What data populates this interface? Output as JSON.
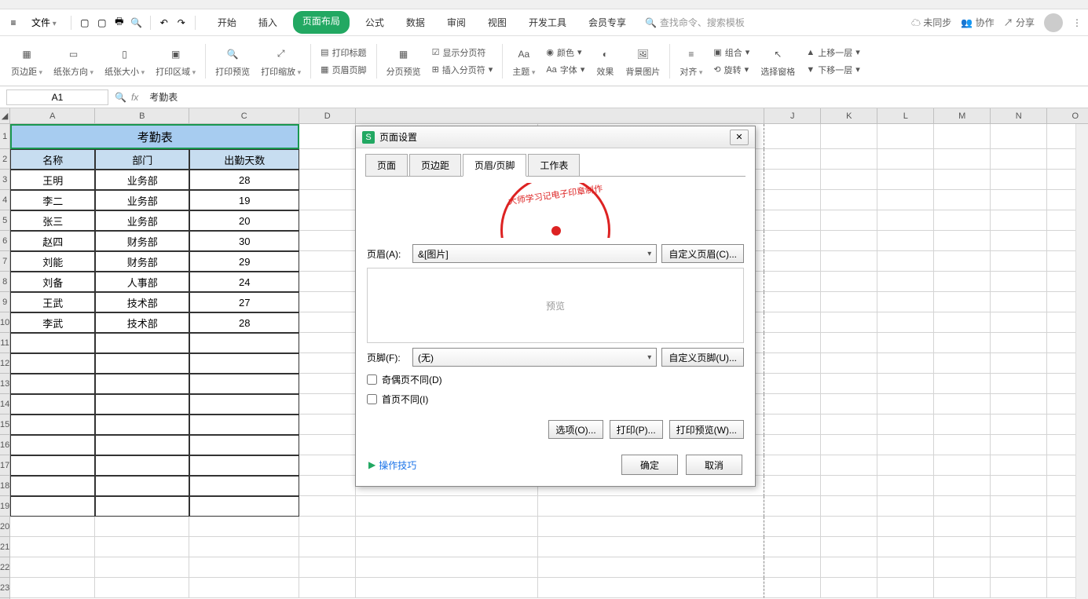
{
  "menubar": {
    "file": "文件",
    "tabs": [
      "开始",
      "插入",
      "页面布局",
      "公式",
      "数据",
      "审阅",
      "视图",
      "开发工具",
      "会员专享"
    ],
    "active_tab": 2,
    "search_placeholder": "查找命令、搜索模板",
    "unsync": "未同步",
    "collab": "协作",
    "share": "分享"
  },
  "toolbar": {
    "margins": "页边距",
    "orientation": "纸张方向",
    "size": "纸张大小",
    "print_area": "打印区域",
    "print_preview": "打印预览",
    "scale": "打印缩放",
    "print_title": "打印标题",
    "header_footer": "页眉页脚",
    "page_break_preview": "分页预览",
    "show_breaks": "显示分页符",
    "insert_break": "插入分页符",
    "theme": "主题",
    "color": "颜色",
    "font": "字体",
    "effect": "效果",
    "bg_image": "背景图片",
    "align": "对齐",
    "group": "组合",
    "rotate": "旋转",
    "select_pane": "选择窗格",
    "move_up": "上移一层",
    "move_down": "下移一层"
  },
  "formula_bar": {
    "cell_ref": "A1",
    "fx": "fx",
    "value": "考勤表"
  },
  "columns": [
    "A",
    "B",
    "C",
    "D",
    "J",
    "K",
    "L",
    "M",
    "N",
    "O"
  ],
  "sheet": {
    "title": "考勤表",
    "headers": [
      "名称",
      "部门",
      "出勤天数"
    ],
    "rows": [
      [
        "王明",
        "业务部",
        "28"
      ],
      [
        "李二",
        "业务部",
        "19"
      ],
      [
        "张三",
        "业务部",
        "20"
      ],
      [
        "赵四",
        "财务部",
        "30"
      ],
      [
        "刘能",
        "财务部",
        "29"
      ],
      [
        "刘备",
        "人事部",
        "24"
      ],
      [
        "王武",
        "技术部",
        "27"
      ],
      [
        "李武",
        "技术部",
        "28"
      ]
    ]
  },
  "dialog": {
    "title": "页面设置",
    "tabs": [
      "页面",
      "页边距",
      "页眉/页脚",
      "工作表"
    ],
    "active_tab": 2,
    "stamp_text": "大师学习记电子印章制作",
    "header_label": "页眉(A):",
    "header_value": "&[图片]",
    "custom_header": "自定义页眉(C)...",
    "preview": "预览",
    "footer_label": "页脚(F):",
    "footer_value": "(无)",
    "custom_footer": "自定义页脚(U)...",
    "odd_even": "奇偶页不同(D)",
    "first_diff": "首页不同(I)",
    "options": "选项(O)...",
    "print": "打印(P)...",
    "print_preview": "打印预览(W)...",
    "tips": "操作技巧",
    "ok": "确定",
    "cancel": "取消"
  }
}
